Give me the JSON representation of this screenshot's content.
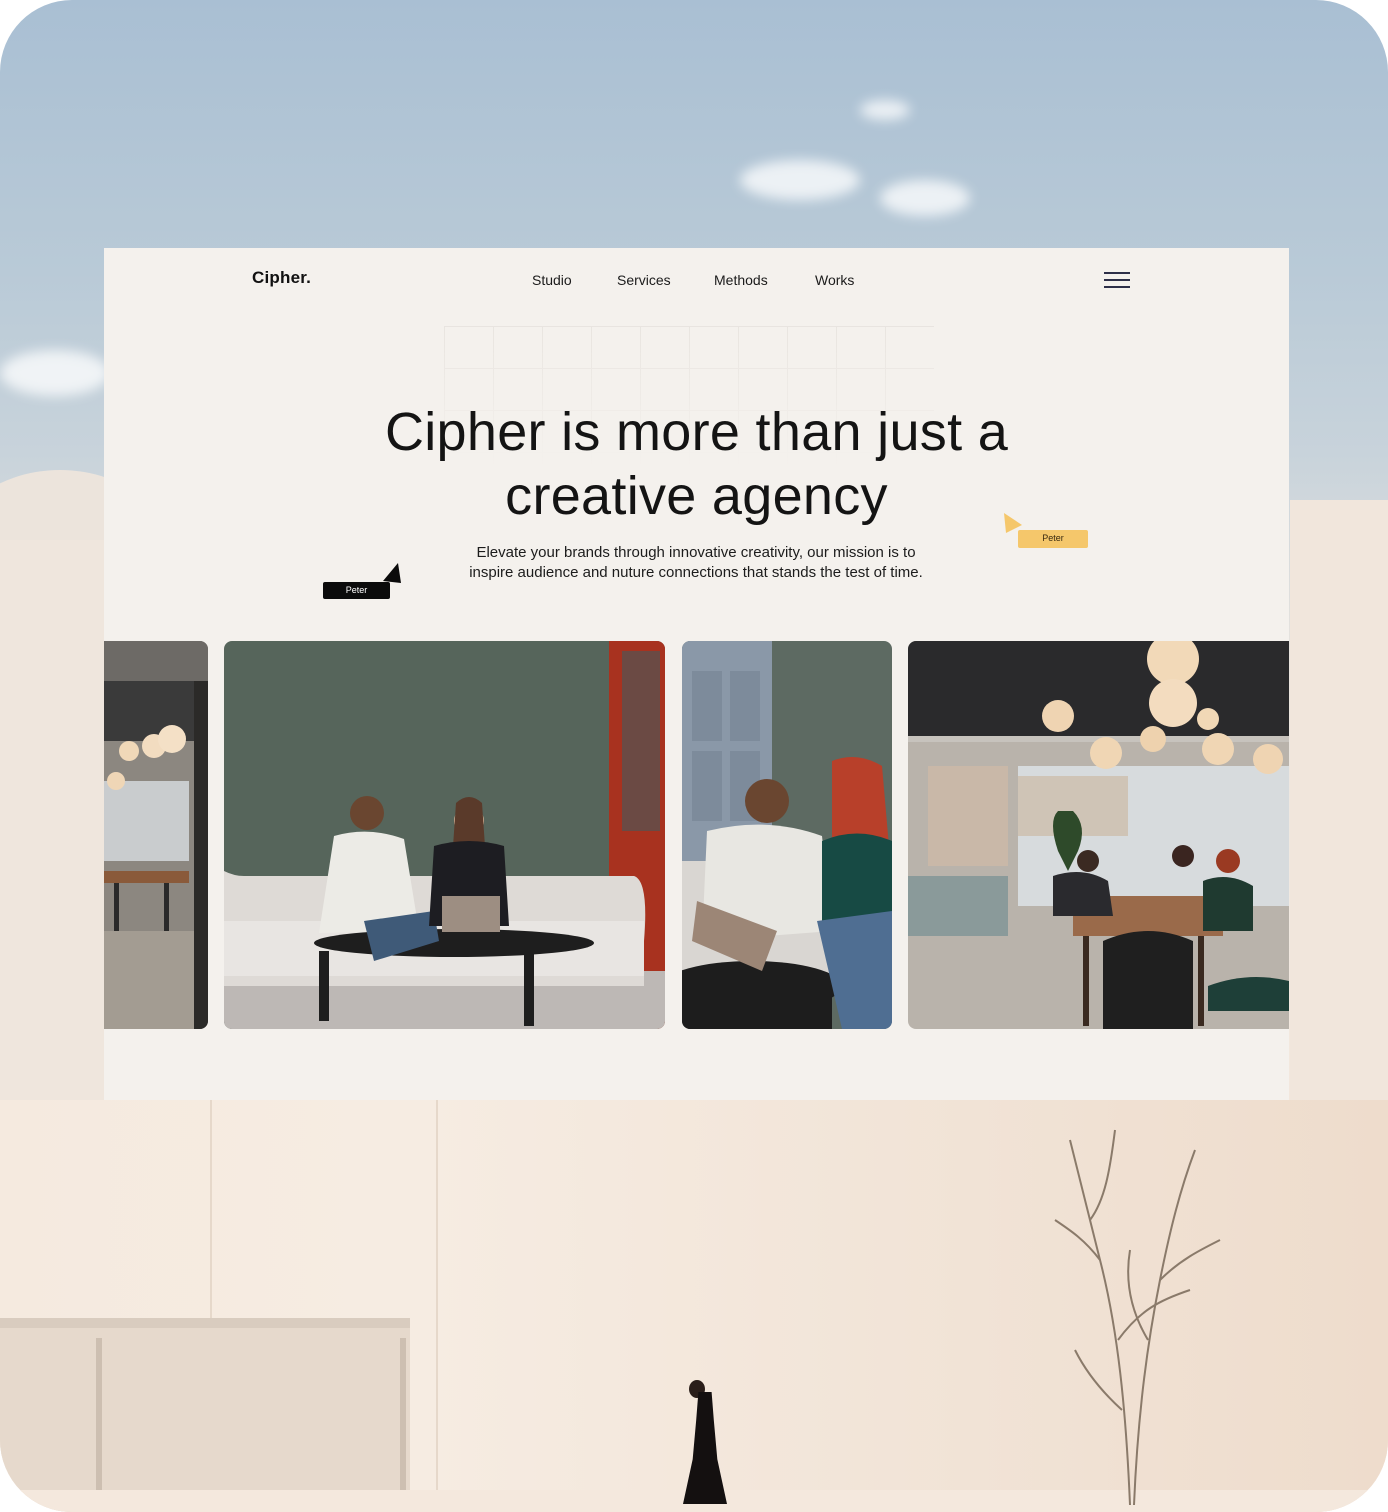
{
  "header": {
    "logo": "Cipher.",
    "nav": [
      {
        "label": "Studio"
      },
      {
        "label": "Services"
      },
      {
        "label": "Methods"
      },
      {
        "label": "Works"
      }
    ]
  },
  "hero": {
    "headline_line1": "Cipher is more than just a",
    "headline_line2": "creative agency",
    "subtext_line1": "Elevate your brands through innovative  creativity, our mission is to",
    "subtext_line2": "inspire audience and nuture connections that stands the test of time."
  },
  "cursors": [
    {
      "name": "Peter",
      "color": "#0b0b0b"
    },
    {
      "name": "Peter",
      "color": "#f5c76b"
    }
  ],
  "gallery": [
    {
      "subject": "office-interior-with-pendant-lights"
    },
    {
      "subject": "two-people-on-sofa-with-laptop"
    },
    {
      "subject": "man-and-red-haired-woman-with-laptop"
    },
    {
      "subject": "team-meeting-at-long-table"
    }
  ],
  "colors": {
    "card_background": "#f4f1ed",
    "text": "#141414",
    "cursor_dark": "#0b0b0b",
    "cursor_yellow": "#f5c76b",
    "menu_icon": "#2d2f48"
  }
}
